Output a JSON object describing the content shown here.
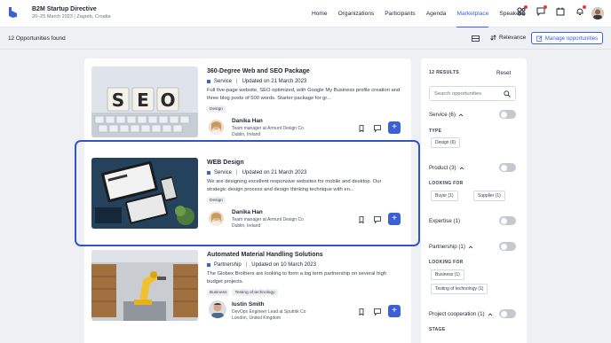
{
  "event": {
    "title": "B2M Startup Directive",
    "subtitle": "20–25 March 2023 | Zagreb, Croatia"
  },
  "nav": [
    "Home",
    "Organizations",
    "Participants",
    "Agenda",
    "Marketplace",
    "Speakers"
  ],
  "nav_active": "Marketplace",
  "toolbar": {
    "found": "12 Opportunities found",
    "sort_label": "Relevance",
    "manage_label": "Manage opportunities"
  },
  "cards": [
    {
      "title": "360-Degree Web and SEO Package",
      "type": "Service",
      "updated": "Updated on 21 March 2023",
      "desc": "Full five-page website, SEO optimized, with Google My Business profile creation and three blog posts of 500 words. Starter package for gr...",
      "tags": [
        "Design"
      ],
      "person": {
        "name": "Danika Han",
        "role": "Team manager at Armunt Design Co",
        "loc": "Dublin, Ireland"
      },
      "image_text": "SEO"
    },
    {
      "title": "WEB Design",
      "type": "Service",
      "updated": "Updated on 21 March 2023",
      "desc": "We are designing excellent responsive websites for mobile and desktop. Our strategic design process and design thinking technique with en...",
      "tags": [
        "Design"
      ],
      "person": {
        "name": "Danika Han",
        "role": "Team manager at Armunt Design Co",
        "loc": "Dublin, Ireland"
      },
      "image_text": ""
    },
    {
      "title": "Automated Material Handling Solutions",
      "type": "Partnership",
      "updated": "Updated on 10 March 2023",
      "desc": "The Globex Brothers are looking to form a log term partnership on several high budget projects.",
      "tags": [
        "Business",
        "Testing of technology"
      ],
      "person": {
        "name": "Iustin Smith",
        "role": "DevOps Engineer Lead at Sputnik Co",
        "loc": "London, United Kingdom"
      },
      "image_text": ""
    }
  ],
  "filters": {
    "results": "12 RESULTS",
    "reset": "Reset",
    "search_placeholder": "Search opportunities",
    "service": "Service (6)",
    "type_label": "TYPE",
    "type_chip": "Design (6)",
    "product": "Product (3)",
    "looking_for": "LOOKING FOR",
    "buyer": "Buyer (1)",
    "supplier": "Supplier (1)",
    "expertise": "Expertise (1)",
    "partnership": "Partnership (1)",
    "business": "Business (1)",
    "testing": "Testing of technology (1)",
    "project": "Project cooperation (1)",
    "stage": "STAGE"
  },
  "colors": {
    "accent": "#3b5fd4",
    "highlight": "#3454c4"
  }
}
